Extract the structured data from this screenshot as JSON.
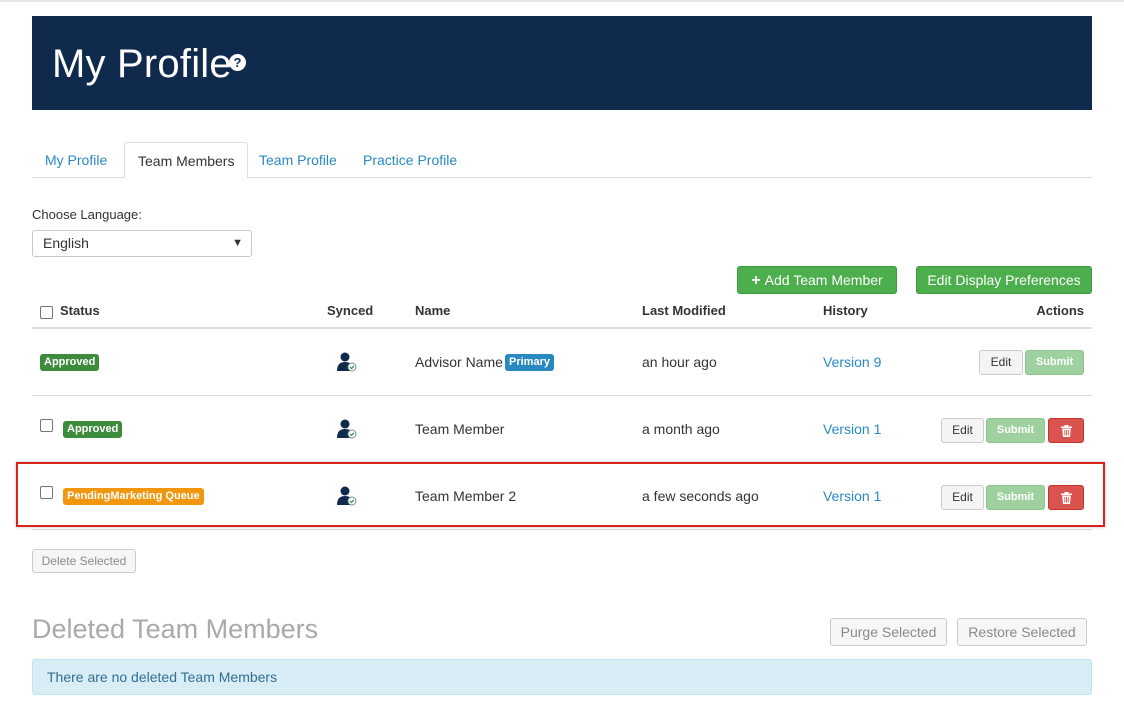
{
  "header": {
    "title": "My Profile",
    "help_glyph": "?"
  },
  "tabs": [
    {
      "label": "My Profile",
      "active": false
    },
    {
      "label": "Team Members",
      "active": true
    },
    {
      "label": "Team Profile",
      "active": false
    },
    {
      "label": "Practice Profile",
      "active": false
    }
  ],
  "language": {
    "label": "Choose Language:",
    "selected": "English"
  },
  "toolbar": {
    "add_label": "Add Team Member",
    "add_icon": "plus-icon",
    "prefs_label": "Edit Display Preferences"
  },
  "table": {
    "columns": [
      "Status",
      "Synced",
      "Name",
      "Last Modified",
      "History",
      "Actions"
    ],
    "rows": [
      {
        "status": "Approved",
        "name": "Advisor Name",
        "name_badge": "Primary",
        "modified": "an hour ago",
        "history": "Version 9",
        "edit": "Edit",
        "submit": "Submit",
        "has_checkbox": false,
        "has_delete": false
      },
      {
        "status": "Approved",
        "name": "Team Member",
        "modified": "a month ago",
        "history": "Version 1",
        "edit": "Edit",
        "submit": "Submit",
        "has_checkbox": true,
        "has_delete": true
      },
      {
        "status": "PendingMarketing Queue",
        "name": "Team Member 2",
        "modified": "a few seconds ago",
        "history": "Version 1",
        "edit": "Edit",
        "submit": "Submit",
        "has_checkbox": true,
        "has_delete": true,
        "highlighted": true
      }
    ]
  },
  "delete_selected_label": "Delete Selected",
  "deleted_section": {
    "title": "Deleted Team Members",
    "purge_label": "Purge Selected",
    "restore_label": "Restore Selected",
    "empty_message": "There are no deleted Team Members"
  },
  "colors": {
    "banner": "#0f2a4c",
    "approved": "#3d8b3d",
    "pending": "#f0960f",
    "primary_badge": "#2a88c0",
    "link": "#2a8ac4",
    "success": "#4cae4c",
    "danger": "#d9534f",
    "highlight_border": "#d9241b"
  }
}
